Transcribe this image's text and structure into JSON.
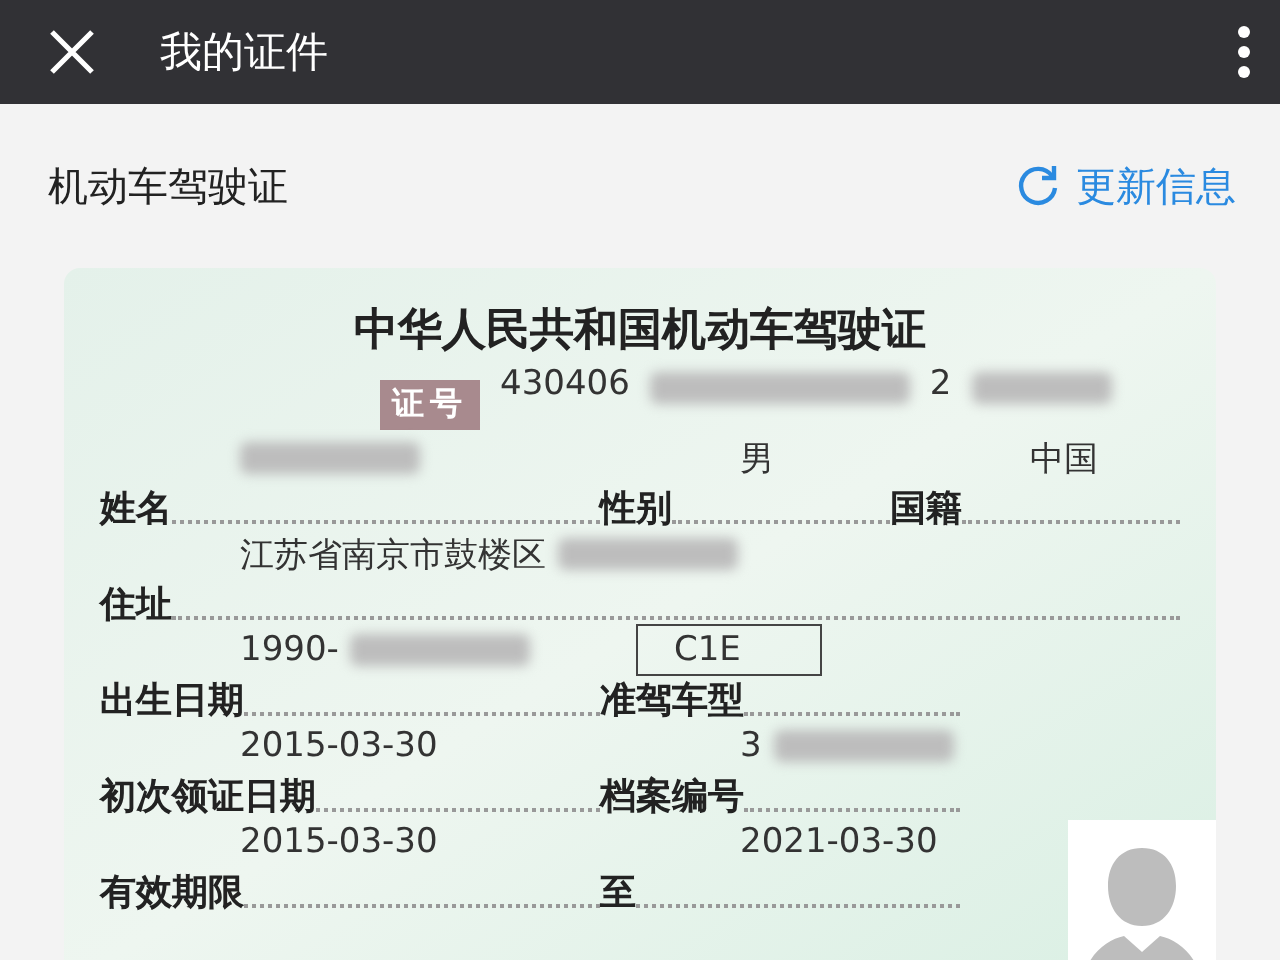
{
  "top_bar": {
    "title": "我的证件"
  },
  "section": {
    "title": "机动车驾驶证",
    "action": "更新信息"
  },
  "license": {
    "title": "中华人民共和国机动车驾驶证",
    "number_label": "证号",
    "number": "430406",
    "number_tail": "2",
    "rows": [
      [
        {
          "label": "姓名",
          "redacted": true,
          "boxed": false
        },
        {
          "label": "性别",
          "value": "男",
          "redacted": false,
          "boxed": false
        },
        {
          "label": "国籍",
          "value": "中国",
          "redacted": false,
          "boxed": false
        }
      ],
      [
        {
          "label": "住址",
          "value": "江苏省南京市鼓楼区",
          "redacted": true,
          "boxed": false
        }
      ],
      [
        {
          "label": "出生日期",
          "value": "1990-",
          "redacted": true,
          "boxed": false
        },
        {
          "label": "准驾车型",
          "value": "C1E",
          "redacted": false,
          "boxed": true
        }
      ],
      [
        {
          "label": "初次领证日期",
          "value": "2015-03-30",
          "redacted": false,
          "boxed": false
        },
        {
          "label": "档案编号",
          "value": "3",
          "redacted": true,
          "boxed": false
        }
      ],
      [
        {
          "label": "有效期限",
          "value": "2015-03-30",
          "redacted": false,
          "boxed": false
        },
        {
          "label": "至",
          "value": "2021-03-30",
          "redacted": false,
          "boxed": false
        }
      ]
    ]
  }
}
